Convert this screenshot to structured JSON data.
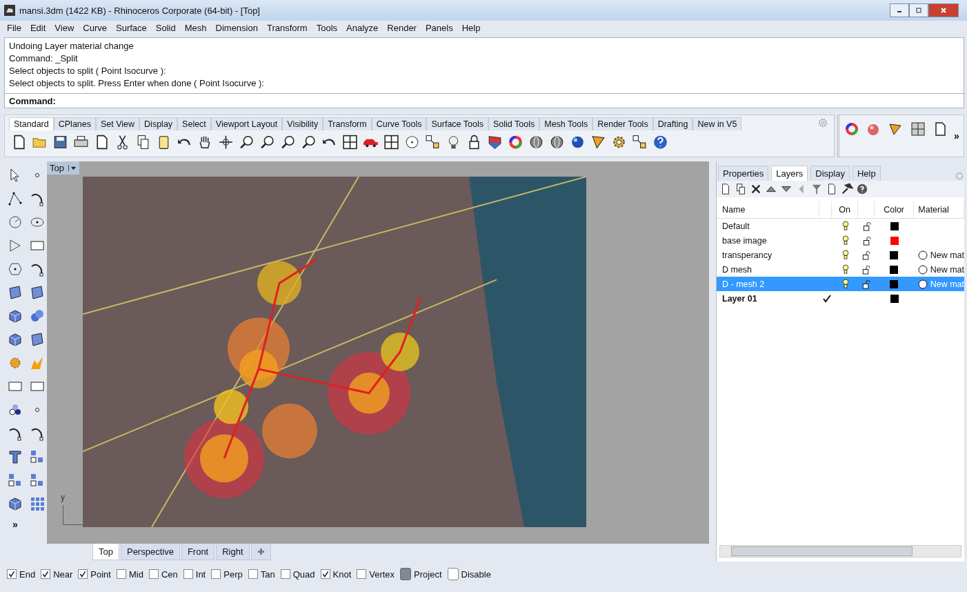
{
  "window": {
    "title": "mansi.3dm (1422 KB) - Rhinoceros Corporate (64-bit) - [Top]"
  },
  "menu": [
    "File",
    "Edit",
    "View",
    "Curve",
    "Surface",
    "Solid",
    "Mesh",
    "Dimension",
    "Transform",
    "Tools",
    "Analyze",
    "Render",
    "Panels",
    "Help"
  ],
  "command_history": [
    "Undoing Layer material change",
    "Command: _Split",
    "Select objects to split ( Point  Isocurve ):",
    "Select objects to split. Press Enter when done ( Point  Isocurve ):"
  ],
  "command_prompt": "Command:",
  "toolbar_tabs": [
    {
      "label": "Standard",
      "selected": true
    },
    {
      "label": "CPlanes",
      "selected": false
    },
    {
      "label": "Set View",
      "selected": false
    },
    {
      "label": "Display",
      "selected": false
    },
    {
      "label": "Select",
      "selected": false
    },
    {
      "label": "Viewport Layout",
      "selected": false
    },
    {
      "label": "Visibility",
      "selected": false
    },
    {
      "label": "Transform",
      "selected": false
    },
    {
      "label": "Curve Tools",
      "selected": false
    },
    {
      "label": "Surface Tools",
      "selected": false
    },
    {
      "label": "Solid Tools",
      "selected": false
    },
    {
      "label": "Mesh Tools",
      "selected": false
    },
    {
      "label": "Render Tools",
      "selected": false
    },
    {
      "label": "Drafting",
      "selected": false
    },
    {
      "label": "New in V5",
      "selected": false
    }
  ],
  "side_toolbar_more": "»",
  "left_toolbar_more": "»",
  "viewport": {
    "title": "Top",
    "axis_label": "y"
  },
  "viewport_tabs": [
    {
      "label": "Top",
      "selected": true
    },
    {
      "label": "Perspective",
      "selected": false
    },
    {
      "label": "Front",
      "selected": false
    },
    {
      "label": "Right",
      "selected": false
    }
  ],
  "osnaps": [
    {
      "label": "End",
      "kind": "check",
      "checked": true
    },
    {
      "label": "Near",
      "kind": "check",
      "checked": true
    },
    {
      "label": "Point",
      "kind": "check",
      "checked": true
    },
    {
      "label": "Mid",
      "kind": "check",
      "checked": false
    },
    {
      "label": "Cen",
      "kind": "check",
      "checked": false
    },
    {
      "label": "Int",
      "kind": "check",
      "checked": false
    },
    {
      "label": "Perp",
      "kind": "check",
      "checked": false
    },
    {
      "label": "Tan",
      "kind": "check",
      "checked": false
    },
    {
      "label": "Quad",
      "kind": "check",
      "checked": false
    },
    {
      "label": "Knot",
      "kind": "check",
      "checked": true
    },
    {
      "label": "Vertex",
      "kind": "check",
      "checked": false
    },
    {
      "label": "Project",
      "kind": "toggle",
      "checked": true
    },
    {
      "label": "Disable",
      "kind": "toggle",
      "checked": false
    }
  ],
  "panel": {
    "tabs": [
      {
        "label": "Properties",
        "selected": false
      },
      {
        "label": "Layers",
        "selected": true
      },
      {
        "label": "Display",
        "selected": false
      },
      {
        "label": "Help",
        "selected": false
      }
    ],
    "columns": [
      "Name",
      "On",
      "Color",
      "Material"
    ],
    "layers": [
      {
        "name": "Default",
        "selected": false,
        "current": false,
        "color": "#000000"
      },
      {
        "name": "base image",
        "selected": false,
        "current": false,
        "color": "#ff0000"
      },
      {
        "name": "transperancy",
        "selected": false,
        "current": false,
        "color": "#000000",
        "material": "New mat"
      },
      {
        "name": "D mesh",
        "selected": false,
        "current": false,
        "color": "#000000",
        "material": "New mat"
      },
      {
        "name": "D - mesh 2",
        "selected": true,
        "current": false,
        "color": "#000000",
        "material": "New mat"
      },
      {
        "name": "Layer 01",
        "selected": false,
        "current": true,
        "color": "#000000"
      }
    ]
  }
}
